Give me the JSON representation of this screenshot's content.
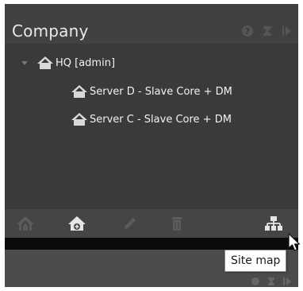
{
  "panel": {
    "title": "Company"
  },
  "header_icons": [
    "help-icon",
    "hourglass-icon",
    "collapse-panel-icon"
  ],
  "tree": {
    "root": {
      "label": "HQ [admin]",
      "expanded": true,
      "icon": "site-icon"
    },
    "children": [
      {
        "label": "Server D - Slave Core + DM",
        "icon": "site-icon"
      },
      {
        "label": "Server C - Slave Core + DM",
        "icon": "site-icon"
      }
    ]
  },
  "toolbar": {
    "buttons": [
      {
        "name": "add-site-group-icon",
        "enabled": false
      },
      {
        "name": "add-site-icon",
        "enabled": true
      },
      {
        "name": "edit-icon",
        "enabled": false
      },
      {
        "name": "delete-icon",
        "enabled": false
      },
      {
        "name": "site-map-icon",
        "enabled": true
      }
    ]
  },
  "tooltip": {
    "text": "Site map"
  },
  "colors": {
    "panel_bg": "#3a3a3a",
    "header_bg": "#414141",
    "toolbar_bg": "#454545",
    "icon_enabled": "#e6e6e6",
    "icon_disabled": "#5c5c5c"
  }
}
